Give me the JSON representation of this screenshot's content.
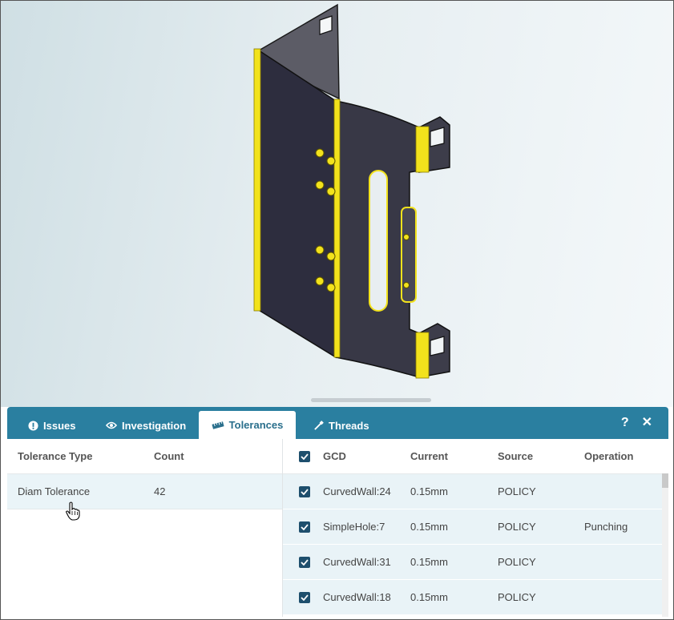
{
  "tabs": [
    {
      "label": "Issues",
      "icon": "exclamation-circle-icon",
      "active": false
    },
    {
      "label": "Investigation",
      "icon": "eye-icon",
      "active": false
    },
    {
      "label": "Tolerances",
      "icon": "ruler-icon",
      "active": true
    },
    {
      "label": "Threads",
      "icon": "screw-icon",
      "active": false
    }
  ],
  "tools": {
    "help": "?",
    "close": "✕"
  },
  "tolerance_summary": {
    "headers": {
      "type": "Tolerance Type",
      "count": "Count"
    },
    "rows": [
      {
        "type": "Diam Tolerance",
        "count": "42"
      }
    ]
  },
  "tolerance_details": {
    "headers": {
      "gcd": "GCD",
      "current": "Current",
      "source": "Source",
      "operation": "Operation"
    },
    "rows": [
      {
        "gcd": "CurvedWall:24",
        "current": "0.15mm",
        "source": "POLICY",
        "operation": "",
        "checked": true
      },
      {
        "gcd": "SimpleHole:7",
        "current": "0.15mm",
        "source": "POLICY",
        "operation": "Punching",
        "checked": true
      },
      {
        "gcd": "CurvedWall:31",
        "current": "0.15mm",
        "source": "POLICY",
        "operation": "",
        "checked": true
      },
      {
        "gcd": "CurvedWall:18",
        "current": "0.15mm",
        "source": "POLICY",
        "operation": "",
        "checked": true
      }
    ]
  },
  "colors": {
    "accent": "#2a7fa0",
    "highlight": "#f2e21c",
    "part": "#2b2b3a"
  }
}
